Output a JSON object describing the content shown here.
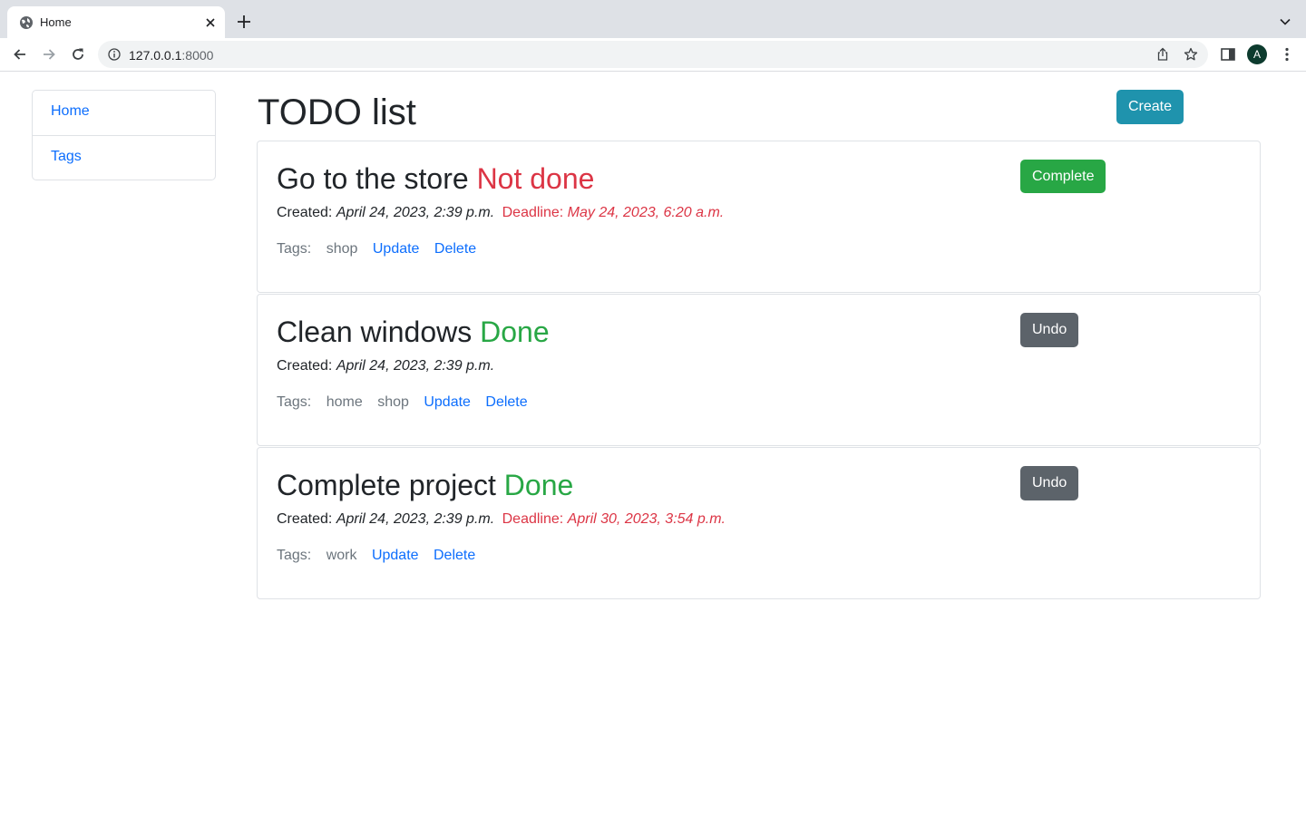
{
  "browser": {
    "tab_title": "Home",
    "url_host": "127.0.0.1",
    "url_port": ":8000",
    "avatar_letter": "A"
  },
  "sidebar": {
    "items": [
      {
        "label": "Home"
      },
      {
        "label": "Tags"
      }
    ]
  },
  "header": {
    "title": "TODO list",
    "create_label": "Create"
  },
  "labels": {
    "created": "Created:",
    "deadline": "Deadline:",
    "tags": "Tags:",
    "update": "Update",
    "delete": "Delete"
  },
  "todos": [
    {
      "title": "Go to the store",
      "status": "Not done",
      "created": "April 24, 2023, 2:39 p.m.",
      "deadline": "May 24, 2023, 6:20 a.m.",
      "tags": [
        "shop"
      ],
      "action_label": "Complete"
    },
    {
      "title": "Clean windows",
      "status": "Done",
      "created": "April 24, 2023, 2:39 p.m.",
      "tags": [
        "home",
        "shop"
      ],
      "action_label": "Undo"
    },
    {
      "title": "Complete project",
      "status": "Done",
      "created": "April 24, 2023, 2:39 p.m.",
      "deadline": "April 30, 2023, 3:54 p.m.",
      "tags": [
        "work"
      ],
      "action_label": "Undo"
    }
  ],
  "colors": {
    "link": "#0d6efd",
    "danger": "#dc3545",
    "success": "#28a745",
    "secondary": "#5c636a",
    "info": "#1f93ad"
  }
}
